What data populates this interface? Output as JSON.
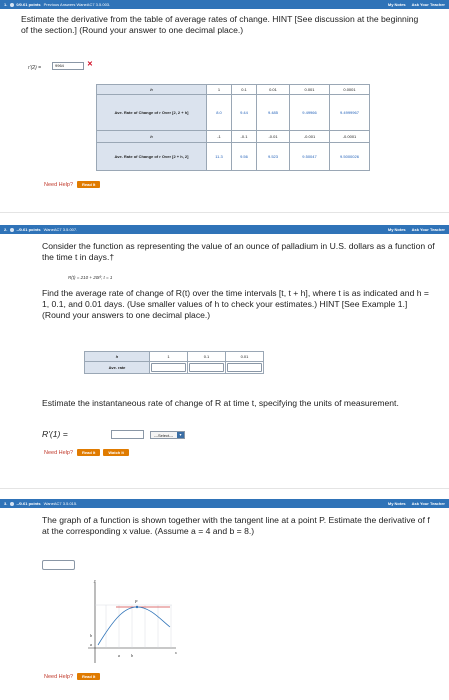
{
  "q1": {
    "num": "1.",
    "points": "0/0.61 points",
    "sub": "Previous Answers  WaneAC7 3.5.003.",
    "notes": "My Notes",
    "ask": "Ask Your Teacher",
    "text": "Estimate the derivative from the table of average rates of change. HINT [See discussion at the beginning of the section.] (Round your answer to one decimal place.)",
    "answer_label": "r'(2)  =",
    "answer_value": "9964",
    "answer_status": "✕",
    "table": {
      "row1_head": "h",
      "h_values": [
        "1",
        "0.1",
        "0.01",
        "0.001",
        "0.0001"
      ],
      "row2_head": "Ave. Rate of Change of r Over [2, 2 + h]",
      "row2_values": [
        "8.0",
        "9.44",
        "9.485",
        "9.49966",
        "9.4999967"
      ],
      "row3_head": "h",
      "neg_h_values": [
        "-1",
        "-0.1",
        "-0.01",
        "-0.001",
        "-0.0001"
      ],
      "row4_head": "Ave. Rate of Change of r Over [2 + h, 2]",
      "row4_values": [
        "11.3",
        "9.56",
        "9.523",
        "9.50047",
        "9.5000026"
      ]
    },
    "need_help": "Need Help?",
    "read_it": "Read It"
  },
  "q2": {
    "num": "2.",
    "points": "–/0.61 points",
    "sub": "WaneAC7 3.5.007.",
    "notes": "My Notes",
    "ask": "Ask Your Teacher",
    "text1": "Consider the function as representing the value of an ounce of palladium in U.S. dollars as a function of the time t in days.†",
    "formula": "R(t) = 210 + 20t³; t = 1",
    "text2": "Find the average rate of change of R(t) over the time intervals [t, t + h], where t is as indicated and h = 1, 0.1, and 0.01 days. (Use smaller values of h to check your estimates.) HINT [See Example 1.] (Round your answers to one decimal place.)",
    "table_h": "h",
    "h_values": [
      "1",
      "0.1",
      "0.01"
    ],
    "table_rate": "Ave. rate",
    "text3": "Estimate the instantaneous rate of change of R at time t, specifying the units of measurement.",
    "deriv_label": "R'(1)  =",
    "select_value": "---Select---",
    "need_help": "Need Help?",
    "read_it": "Read It",
    "watch_it": "Watch It"
  },
  "q3": {
    "num": "3.",
    "points": "–/0.61 points",
    "sub": "WaneAC7 3.5.015.",
    "notes": "My Notes",
    "ask": "Ask Your Teacher",
    "text": "The graph of a function is shown together with the tangent line at a point P. Estimate the derivative of f at the corresponding x value. (Assume a = 4 and b = 8.)",
    "graph_y": "y",
    "graph_x": "x",
    "graph_p": "P",
    "graph_a": "a",
    "graph_b": "b",
    "need_help": "Need Help?",
    "read_it": "Read It"
  }
}
